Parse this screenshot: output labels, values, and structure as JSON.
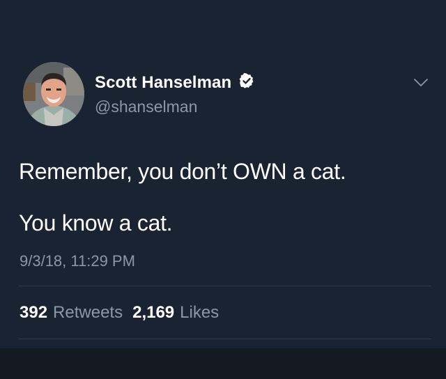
{
  "user": {
    "name": "Scott Hanselman",
    "handle": "@shanselman",
    "verified": true
  },
  "tweet": {
    "line1": "Remember, you don’t OWN a cat.",
    "line2": "You know a cat.",
    "timestamp": "9/3/18, 11:29 PM"
  },
  "stats": {
    "retweets_count": "392",
    "retweets_label": "Retweets",
    "likes_count": "2,169",
    "likes_label": "Likes"
  },
  "icons": {
    "verified": "verified-badge-icon",
    "menu": "chevron-down-icon"
  },
  "colors": {
    "background": "#1a2332",
    "secondary_text": "#8b98a6",
    "verified_badge": "#ffffff"
  }
}
